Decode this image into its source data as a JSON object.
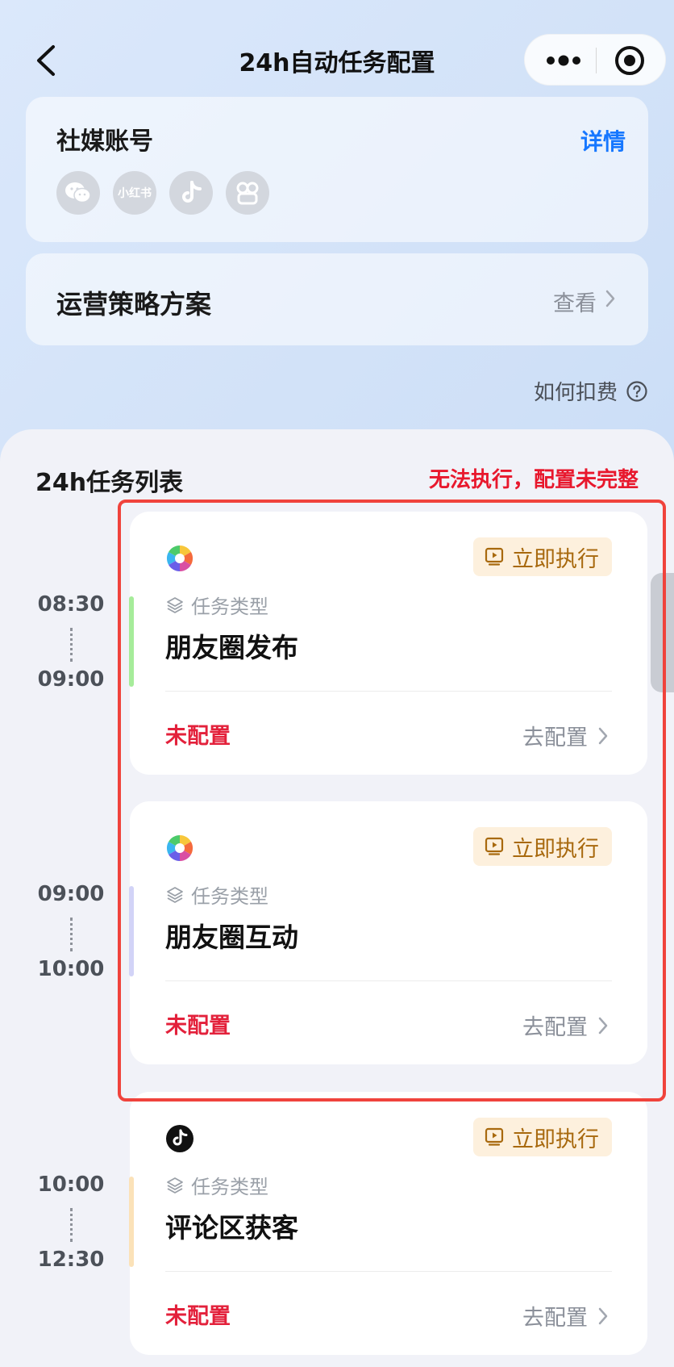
{
  "nav": {
    "title": "24h自动任务配置",
    "back_icon": "chevron-left-icon",
    "more_icon": "more-dots-icon",
    "target_icon": "target-icon"
  },
  "social": {
    "label": "社媒账号",
    "detail_label": "详情",
    "icons": [
      {
        "name": "wechat-icon",
        "text": ""
      },
      {
        "name": "xiaohongshu-icon",
        "text": "小红书"
      },
      {
        "name": "douyin-icon",
        "text": ""
      },
      {
        "name": "wechat-channels-icon",
        "text": ""
      }
    ]
  },
  "strategy": {
    "label": "运营策略方案",
    "view_label": "查看"
  },
  "fee": {
    "label": "如何扣费"
  },
  "task_list": {
    "title": "24h任务列表",
    "warning": "无法执行，配置未完整"
  },
  "tasks": [
    {
      "start": "08:30",
      "end": "09:00",
      "app_icon": "wechat-moments-icon",
      "exec_label": "立即执行",
      "type_label": "任务类型",
      "name": "朋友圈发布",
      "status": "未配置",
      "config_label": "去配置",
      "accent": "#a6ec9a"
    },
    {
      "start": "09:00",
      "end": "10:00",
      "app_icon": "wechat-moments-icon",
      "exec_label": "立即执行",
      "type_label": "任务类型",
      "name": "朋友圈互动",
      "status": "未配置",
      "config_label": "去配置",
      "accent": "#d2d3f7"
    },
    {
      "start": "10:00",
      "end": "12:30",
      "app_icon": "douyin-icon",
      "exec_label": "立即执行",
      "type_label": "任务类型",
      "name": "评论区获客",
      "status": "未配置",
      "config_label": "去配置",
      "accent": "#fbe2b8"
    }
  ],
  "colors": {
    "accent_blue": "#1677ff",
    "warning_red": "#e8182d",
    "status_red": "#e3213b",
    "exec_bg": "#fdf0dd",
    "exec_text": "#a8690e"
  }
}
